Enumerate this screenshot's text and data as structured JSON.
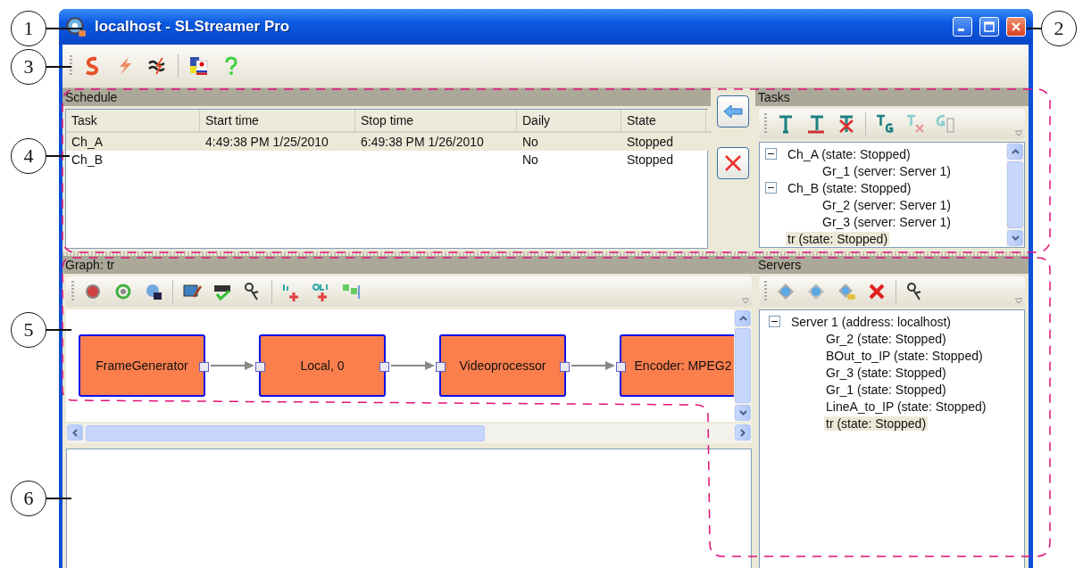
{
  "callouts": [
    "1",
    "2",
    "3",
    "4",
    "5",
    "6"
  ],
  "window": {
    "title": "localhost - SLStreamer Pro"
  },
  "schedule": {
    "title": "Schedule",
    "columns": [
      "Task",
      "Start time",
      "Stop time",
      "Daily",
      "State"
    ],
    "rows": [
      {
        "task": "Ch_A",
        "start_time": "4:49:38 PM 1/25/2010",
        "stop_time": "6:49:38 PM 1/26/2010",
        "daily": "No",
        "state": "Stopped",
        "selected": true
      },
      {
        "task": "Ch_B",
        "daily": "No",
        "state": "Stopped",
        "selected": false
      }
    ]
  },
  "tasks": {
    "title": "Tasks",
    "tree": [
      {
        "label": "Ch_A (state: Stopped)",
        "expanded": true,
        "selected": false,
        "children": [
          {
            "label": "Gr_1 (server: Server 1)",
            "selected": false
          }
        ]
      },
      {
        "label": "Ch_B (state: Stopped)",
        "expanded": true,
        "selected": false,
        "children": [
          {
            "label": "Gr_2 (server: Server 1)",
            "selected": false
          },
          {
            "label": "Gr_3 (server: Server 1)",
            "selected": false
          }
        ]
      },
      {
        "label": "tr (state: Stopped)",
        "selected": true
      }
    ]
  },
  "graph": {
    "title": "Graph: tr",
    "nodes": [
      "FrameGenerator",
      "Local, 0",
      "Videoprocessor",
      "Encoder: MPEG2"
    ]
  },
  "servers": {
    "title": "Servers",
    "tree": [
      {
        "label": "Server 1 (address: localhost)",
        "expanded": true,
        "selected": false,
        "children": [
          {
            "label": "Gr_2 (state: Stopped)",
            "selected": false
          },
          {
            "label": "BOut_to_IP (state: Stopped)",
            "selected": false
          },
          {
            "label": "Gr_3 (state: Stopped)",
            "selected": false
          },
          {
            "label": "Gr_1 (state: Stopped)",
            "selected": false
          },
          {
            "label": "LineA_to_IP (state: Stopped)",
            "selected": false
          },
          {
            "label": "tr (state: Stopped)",
            "selected": true
          }
        ]
      }
    ]
  }
}
